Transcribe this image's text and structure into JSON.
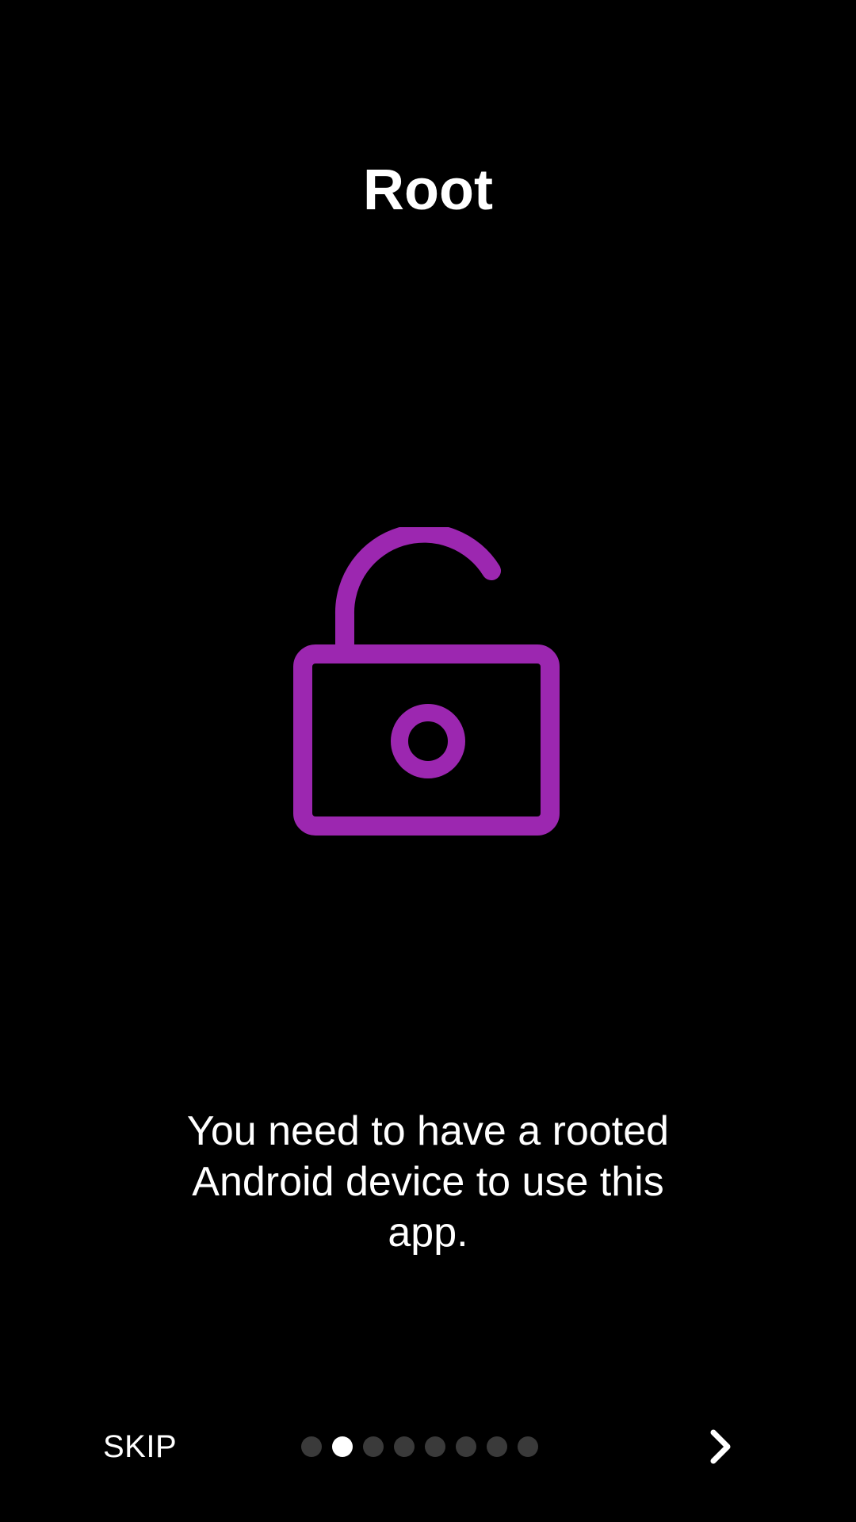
{
  "screen": {
    "title": "Root",
    "description": "You need to have a rooted Android device to use this app.",
    "icon": "unlocked-padlock-icon",
    "icon_color": "#9C27B0"
  },
  "navigation": {
    "skip_label": "SKIP",
    "next_icon": "chevron-right-icon",
    "pages_total": 8,
    "current_page": 2
  },
  "colors": {
    "background": "#000000",
    "text": "#FFFFFF",
    "dot_active": "#FFFFFF",
    "dot_inactive": "#3A3A3A"
  }
}
